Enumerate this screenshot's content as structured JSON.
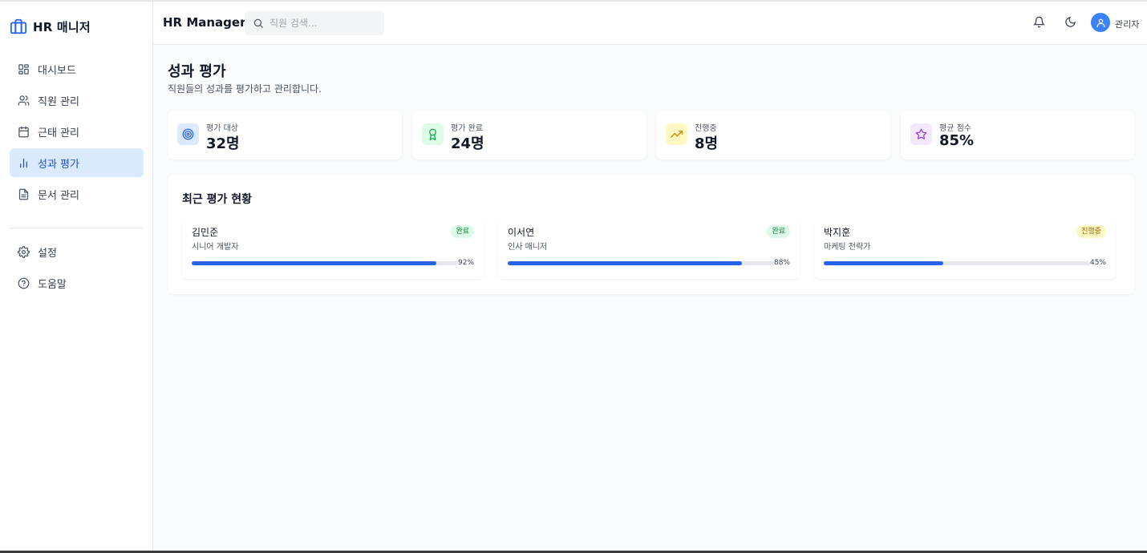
{
  "sidebar": {
    "brand": "HR 매니저",
    "items": [
      {
        "label": "대시보드",
        "icon": "grid-icon"
      },
      {
        "label": "직원 관리",
        "icon": "users-icon"
      },
      {
        "label": "근태 관리",
        "icon": "calendar-icon"
      },
      {
        "label": "성과 평가",
        "icon": "bar-chart-icon",
        "active": true
      },
      {
        "label": "문서 관리",
        "icon": "file-icon"
      }
    ],
    "bottom_items": [
      {
        "label": "설정",
        "icon": "gear-icon"
      },
      {
        "label": "도움말",
        "icon": "help-icon"
      }
    ]
  },
  "header": {
    "title": "HR Manager",
    "search_placeholder": "직원 검색...",
    "user_label": "관리자"
  },
  "page": {
    "title": "성과 평가",
    "subtitle": "직원들의 성과를 평가하고 관리합니다."
  },
  "stats": [
    {
      "label": "평가 대상",
      "value": "32명",
      "icon": "target-icon",
      "color": "#2563eb"
    },
    {
      "label": "평가 완료",
      "value": "24명",
      "icon": "award-icon",
      "color": "#16a34a"
    },
    {
      "label": "진행중",
      "value": "8명",
      "icon": "trending-up-icon",
      "color": "#ca8a04"
    },
    {
      "label": "평균 점수",
      "value": "85%",
      "icon": "star-icon",
      "color": "#9333ea"
    }
  ],
  "recent": {
    "title": "최근 평가 현황",
    "items": [
      {
        "name": "김민준",
        "role": "시니어 개발자",
        "status": "완료",
        "progress_label": "92%",
        "progress": 92
      },
      {
        "name": "이서연",
        "role": "인사 매니저",
        "status": "완료",
        "progress_label": "88%",
        "progress": 88
      },
      {
        "name": "박지훈",
        "role": "마케팅 전략가",
        "status": "진행중",
        "progress_label": "45%",
        "progress": 45
      }
    ]
  },
  "colors": {
    "accent": "#2563eb",
    "active_bg": "#dbeafe",
    "done_badge_bg": "#dcfce7",
    "progress_badge_bg": "#fef9c3"
  }
}
